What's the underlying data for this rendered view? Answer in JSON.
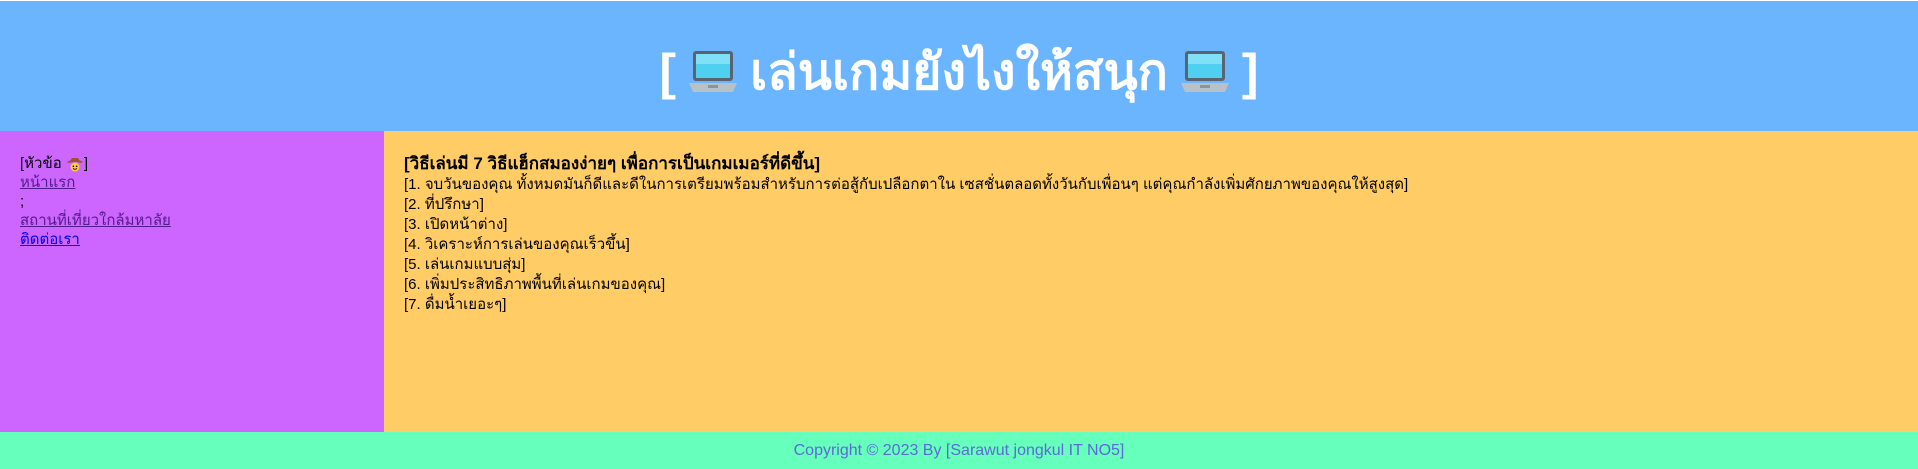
{
  "header": {
    "title_open": "[",
    "title_text": "เล่นเกมยังไงให้สนุก",
    "title_close": "]",
    "icon": "laptop-icon"
  },
  "sidebar": {
    "heading": "[หัวข้อ",
    "heading_close": "]",
    "heading_icon": "cowboy-face-icon",
    "links": [
      {
        "label": "หน้าแรก"
      },
      {
        "label": ";"
      },
      {
        "label": "สถานที่เที่ยวใกล้มหาลัย"
      },
      {
        "label": "ติดต่อเรา"
      }
    ]
  },
  "main": {
    "title": "[วิธีเล่นมี 7 วิธีแฮ็กสมองง่ายๆ เพื่อการเป็นเกมเมอร์ที่ดีขึ้น]",
    "tips": [
      "[1. จบวันของคุณ ทั้งหมดมันก็ดีและดีในการเตรียมพร้อมสำหรับการต่อสู้กับเปลือกตาใน เซสชั่นตลอดทั้งวันกับเพื่อนๆ แต่คุณกำลังเพิ่มศักยภาพของคุณให้สูงสุด]",
      "[2. ที่ปรึกษา]",
      "[3. เปิดหน้าต่าง]",
      "[4. วิเคราะห์การเล่นของคุณเร็วขึ้น]",
      "[5. เล่นเกมแบบสุ่ม]",
      "[6. เพิ่มประสิทธิภาพพื้นที่เล่นเกมของคุณ]",
      "[7. ดื่มน้ำเยอะๆ]"
    ]
  },
  "footer": {
    "text": "Copyright © 2023 By [Sarawut jongkul IT NO5]"
  },
  "colors": {
    "header_bg": "#6bb5ff",
    "sidebar_bg": "#cc66ff",
    "content_bg": "#ffcc66",
    "footer_bg": "#66ffbb",
    "footer_text": "#5a6bd8"
  }
}
